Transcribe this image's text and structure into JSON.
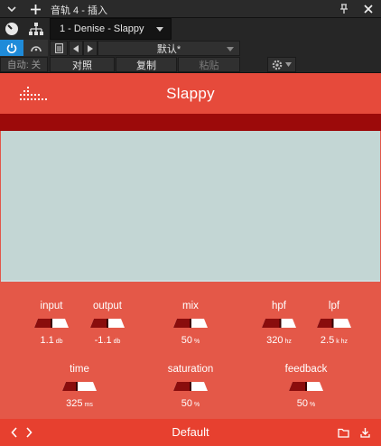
{
  "window": {
    "title": "音轨 4 - 插入",
    "icons": [
      "chevron-down-icon",
      "plus-icon",
      "pin-icon",
      "close-icon"
    ]
  },
  "host": {
    "device_selector": "1 - Denise - Slappy",
    "preset_name": "默认*",
    "auto_label": "自动: 关",
    "compare_label": "对照",
    "copy_label": "复制",
    "paste_label": "粘贴"
  },
  "plugin": {
    "title": "Slappy",
    "colors": {
      "accent": "#e64a3b",
      "dark": "#9c0a0a",
      "display": "#c3d6d4"
    },
    "knobs": [
      {
        "id": "input",
        "label": "input",
        "value": "1.1",
        "unit": "db",
        "level": 0.5
      },
      {
        "id": "output",
        "label": "output",
        "value": "-1.1",
        "unit": "db",
        "level": 0.5
      },
      {
        "id": "mix",
        "label": "mix",
        "value": "50",
        "unit": "%",
        "level": 0.5
      },
      {
        "id": "hpf",
        "label": "hpf",
        "value": "320",
        "unit": "hz",
        "level": 0.55
      },
      {
        "id": "lpf",
        "label": "lpf",
        "value": "2.5",
        "unit": "k hz",
        "level": 0.45
      },
      {
        "id": "time",
        "label": "time",
        "value": "325",
        "unit": "ms",
        "level": 0.4
      },
      {
        "id": "saturation",
        "label": "saturation",
        "value": "50",
        "unit": "%",
        "level": 0.5
      },
      {
        "id": "feedback",
        "label": "feedback",
        "value": "50",
        "unit": "%",
        "level": 0.5
      }
    ],
    "footer_preset": "Default",
    "footer_icons": [
      "chevron-left-icon",
      "chevron-right-icon",
      "folder-icon",
      "download-icon"
    ]
  }
}
